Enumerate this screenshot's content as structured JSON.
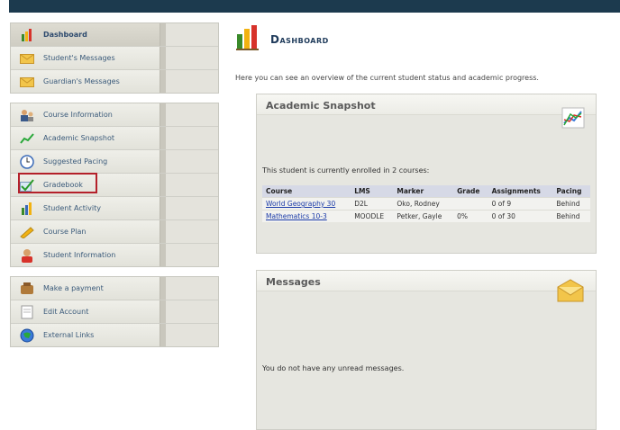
{
  "sidebar": {
    "groups": [
      [
        {
          "label": "Dashboard",
          "icon": "dashboard-icon",
          "active": true
        },
        {
          "label": "Student's Messages",
          "icon": "envelope-icon"
        },
        {
          "label": "Guardian's Messages",
          "icon": "envelope-icon"
        }
      ],
      [
        {
          "label": "Course Information",
          "icon": "people-icon"
        },
        {
          "label": "Academic Snapshot",
          "icon": "chart-icon"
        },
        {
          "label": "Suggested Pacing",
          "icon": "clock-icon"
        },
        {
          "label": "Gradebook",
          "icon": "checkmark-icon"
        },
        {
          "label": "Student Activity",
          "icon": "activity-icon"
        },
        {
          "label": "Course Plan",
          "icon": "plan-icon"
        },
        {
          "label": "Student Information",
          "icon": "user-icon"
        }
      ],
      [
        {
          "label": "Make a payment",
          "icon": "payment-icon"
        },
        {
          "label": "Edit Account",
          "icon": "account-icon"
        },
        {
          "label": "External Links",
          "icon": "globe-icon"
        }
      ]
    ]
  },
  "header": {
    "title": "Dashboard"
  },
  "intro": "Here you can see an overview of the current student status and academic progress.",
  "snapshot": {
    "title": "Academic Snapshot",
    "enrollment": "This student is currently enrolled in 2 courses:",
    "columns": [
      "Course",
      "LMS",
      "Marker",
      "Grade",
      "Assignments",
      "Pacing"
    ],
    "rows": [
      [
        "World Geography 30",
        "D2L",
        "Oko, Rodney",
        "",
        "0 of 9",
        "Behind"
      ],
      [
        "Mathematics 10-3",
        "MOODLE",
        "Petker, Gayle",
        "0%",
        "0 of 30",
        "Behind"
      ]
    ]
  },
  "messages": {
    "title": "Messages",
    "empty": "You do not have any unread messages."
  },
  "colors": {
    "topbar": "#1c3a4e",
    "link": "#1a3aa8",
    "highlight": "#b4202a"
  }
}
